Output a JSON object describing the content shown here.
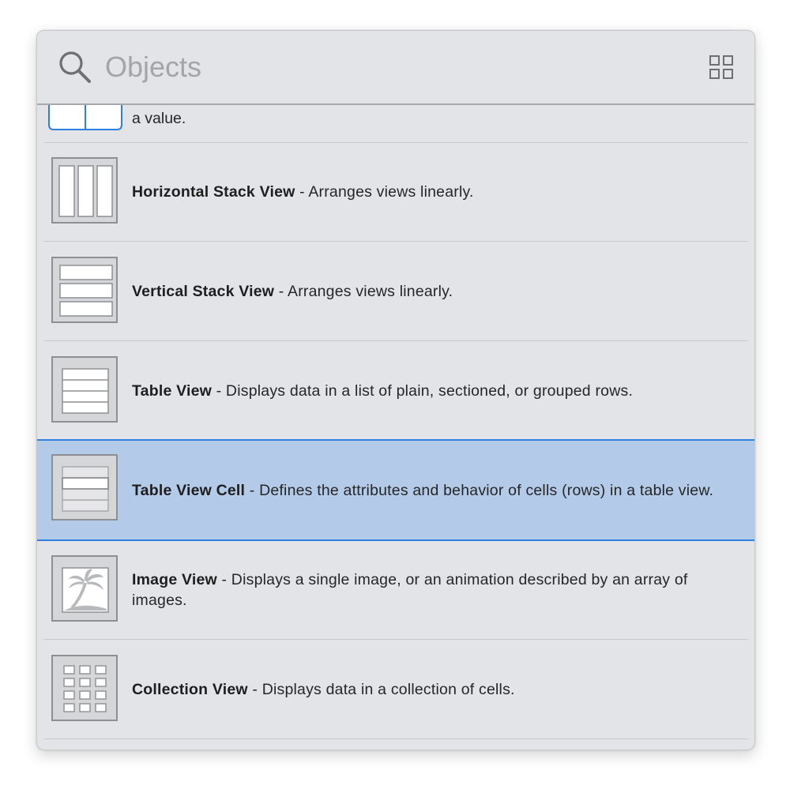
{
  "search": {
    "placeholder": "Objects",
    "icon": "search-icon",
    "toggle_icon": "grid-view-icon"
  },
  "colors": {
    "panel_background": "#e3e4e7",
    "selection_fill": "#b3cae8",
    "selection_border": "#2f7fe0",
    "placeholder_text": "#a4a5a8"
  },
  "items": [
    {
      "title": "",
      "description": "a value.",
      "icon": "segmented-control-icon",
      "selected": false
    },
    {
      "title": "Horizontal Stack View",
      "description": " - Arranges views linearly.",
      "icon": "horizontal-stack-view-icon",
      "selected": false
    },
    {
      "title": "Vertical Stack View",
      "description": " - Arranges views linearly.",
      "icon": "vertical-stack-view-icon",
      "selected": false
    },
    {
      "title": "Table View",
      "description": " - Displays data in a list of plain, sectioned, or grouped rows.",
      "icon": "table-view-icon",
      "selected": false
    },
    {
      "title": "Table View Cell",
      "description": " - Defines the attributes and behavior of cells (rows) in a table view.",
      "icon": "table-view-cell-icon",
      "selected": true
    },
    {
      "title": "Image View",
      "description": " - Displays a single image, or an animation described by an array of images.",
      "icon": "image-view-icon",
      "selected": false
    },
    {
      "title": "Collection View",
      "description": " - Displays data in a collection of cells.",
      "icon": "collection-view-icon",
      "selected": false
    }
  ]
}
